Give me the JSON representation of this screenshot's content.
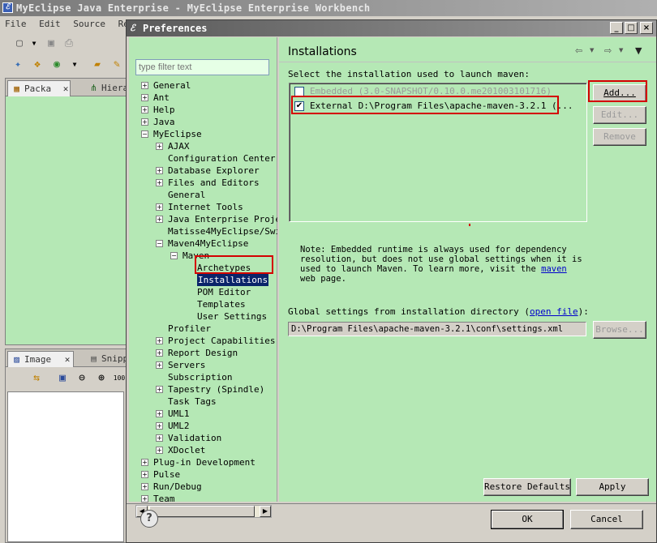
{
  "workbench": {
    "title": "MyEclipse Java Enterprise - MyEclipse Enterprise Workbench",
    "menu": [
      "File",
      "Edit",
      "Source",
      "Refa"
    ],
    "views": {
      "package_tab": "Packa",
      "hierarchy_tab": "Hiera",
      "image_tab": "Image",
      "snippets_tab": "Snipp"
    }
  },
  "dialog": {
    "title": "Preferences",
    "window_buttons": {
      "minimize": "_",
      "maximize": "□",
      "close": "×"
    },
    "filter_placeholder": "type filter text",
    "tree": [
      {
        "label": "General",
        "expander": "+"
      },
      {
        "label": "Ant",
        "expander": "+"
      },
      {
        "label": "Help",
        "expander": "+"
      },
      {
        "label": "Java",
        "expander": "+"
      },
      {
        "label": "MyEclipse",
        "expander": "−"
      },
      {
        "label": "AJAX",
        "expander": "+"
      },
      {
        "label": "Configuration Center",
        "expander": ""
      },
      {
        "label": "Database Explorer",
        "expander": "+"
      },
      {
        "label": "Files and Editors",
        "expander": "+"
      },
      {
        "label": "General",
        "expander": ""
      },
      {
        "label": "Internet Tools",
        "expander": "+"
      },
      {
        "label": "Java Enterprise Proje",
        "expander": "+"
      },
      {
        "label": "Matisse4MyEclipse/Swi",
        "expander": ""
      },
      {
        "label": "Maven4MyEclipse",
        "expander": "−"
      },
      {
        "label": "Maven",
        "expander": "−"
      },
      {
        "label": "Archetypes",
        "expander": ""
      },
      {
        "label": "Installations",
        "expander": ""
      },
      {
        "label": "POM Editor",
        "expander": ""
      },
      {
        "label": "Templates",
        "expander": ""
      },
      {
        "label": "User Settings",
        "expander": ""
      },
      {
        "label": "Profiler",
        "expander": ""
      },
      {
        "label": "Project Capabilities",
        "expander": "+"
      },
      {
        "label": "Report Design",
        "expander": "+"
      },
      {
        "label": "Servers",
        "expander": "+"
      },
      {
        "label": "Subscription",
        "expander": ""
      },
      {
        "label": "Tapestry (Spindle)",
        "expander": "+"
      },
      {
        "label": "Task Tags",
        "expander": ""
      },
      {
        "label": "UML1",
        "expander": "+"
      },
      {
        "label": "UML2",
        "expander": "+"
      },
      {
        "label": "Validation",
        "expander": "+"
      },
      {
        "label": "XDoclet",
        "expander": "+"
      },
      {
        "label": "Plug-in Development",
        "expander": "+"
      },
      {
        "label": "Pulse",
        "expander": "+"
      },
      {
        "label": "Run/Debug",
        "expander": "+"
      },
      {
        "label": "Team",
        "expander": "+"
      }
    ],
    "page": {
      "title": "Installations",
      "select_label": "Select the installation used to launch maven:",
      "installations": [
        {
          "label": "Embedded (3.0-SNAPSHOT/0.10.0.me201003101716)",
          "checked": false,
          "enabled": false
        },
        {
          "label": "External D:\\Program Files\\apache-maven-3.2.1 (...",
          "checked": true,
          "enabled": true
        }
      ],
      "buttons": {
        "add": "Add...",
        "edit": "Edit...",
        "remove": "Remove"
      },
      "note_prefix": "Note: Embedded runtime is always used for dependency resolution, but does not use global settings when it is used to launch Maven. To learn more, visit the ",
      "note_link": "maven",
      "note_suffix": " web page.",
      "global_label": "Global settings from installation directory (",
      "global_link": "open file",
      "global_label_end": "):",
      "global_path": "D:\\Program Files\\apache-maven-3.2.1\\conf\\settings.xml",
      "browse": "Browse...",
      "restore_defaults": "Restore Defaults",
      "apply": "Apply"
    },
    "ok": "OK",
    "cancel": "Cancel",
    "help": "?"
  },
  "colors": {
    "pane_bg": "#b5e8b5",
    "highlight": "#d40000",
    "selection": "#0a246a"
  }
}
